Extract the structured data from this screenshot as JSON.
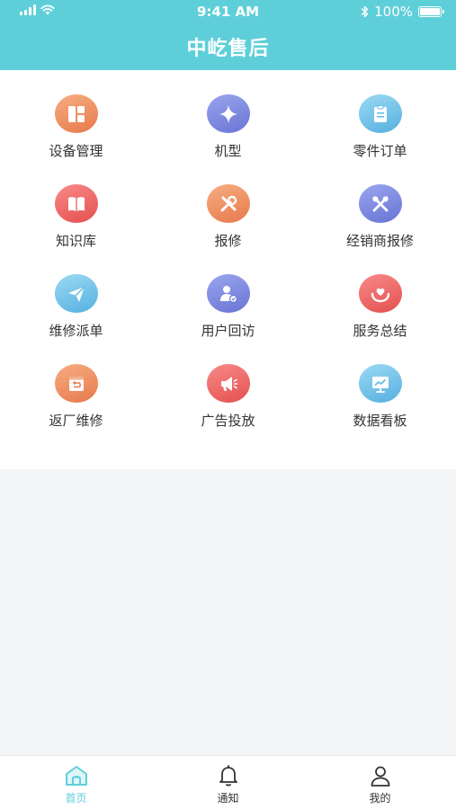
{
  "status_bar": {
    "time": "9:41 AM",
    "battery": "100%",
    "icons": [
      "signal-icon",
      "wifi-icon",
      "bluetooth-icon",
      "battery-icon"
    ]
  },
  "header": {
    "title": "中屹售后",
    "color": "#5ecfd9"
  },
  "grid": [
    {
      "label": "设备管理",
      "icon": "device-management-icon",
      "colors": [
        "#f4a274",
        "#e9845a"
      ]
    },
    {
      "label": "机型",
      "icon": "model-icon",
      "colors": [
        "#8f9be8",
        "#6b76d6"
      ]
    },
    {
      "label": "零件订单",
      "icon": "parts-order-icon",
      "colors": [
        "#8fd3f0",
        "#5cb6e2"
      ]
    },
    {
      "label": "知识库",
      "icon": "knowledge-base-icon",
      "colors": [
        "#f47c7c",
        "#e65555"
      ]
    },
    {
      "label": "报修",
      "icon": "repair-report-icon",
      "colors": [
        "#f4a274",
        "#e9845a"
      ]
    },
    {
      "label": "经销商报修",
      "icon": "dealer-repair-icon",
      "colors": [
        "#8f9be8",
        "#6b76d6"
      ]
    },
    {
      "label": "维修派单",
      "icon": "dispatch-icon",
      "colors": [
        "#8fd3f0",
        "#5cb6e2"
      ]
    },
    {
      "label": "用户回访",
      "icon": "user-visit-icon",
      "colors": [
        "#8f9be8",
        "#6b76d6"
      ]
    },
    {
      "label": "服务总结",
      "icon": "service-summary-icon",
      "colors": [
        "#f47c7c",
        "#e65555"
      ]
    },
    {
      "label": "返厂维修",
      "icon": "return-factory-icon",
      "colors": [
        "#f4a274",
        "#e9845a"
      ]
    },
    {
      "label": "广告投放",
      "icon": "advertising-icon",
      "colors": [
        "#f47c7c",
        "#e65555"
      ]
    },
    {
      "label": "数据看板",
      "icon": "data-dashboard-icon",
      "colors": [
        "#8fd3f0",
        "#5cb6e2"
      ]
    }
  ],
  "tabbar": {
    "items": [
      {
        "label": "首页",
        "icon": "home-icon",
        "active": true
      },
      {
        "label": "通知",
        "icon": "bell-icon",
        "active": false
      },
      {
        "label": "我的",
        "icon": "user-icon",
        "active": false
      }
    ],
    "active_color": "#5ecfd9"
  }
}
